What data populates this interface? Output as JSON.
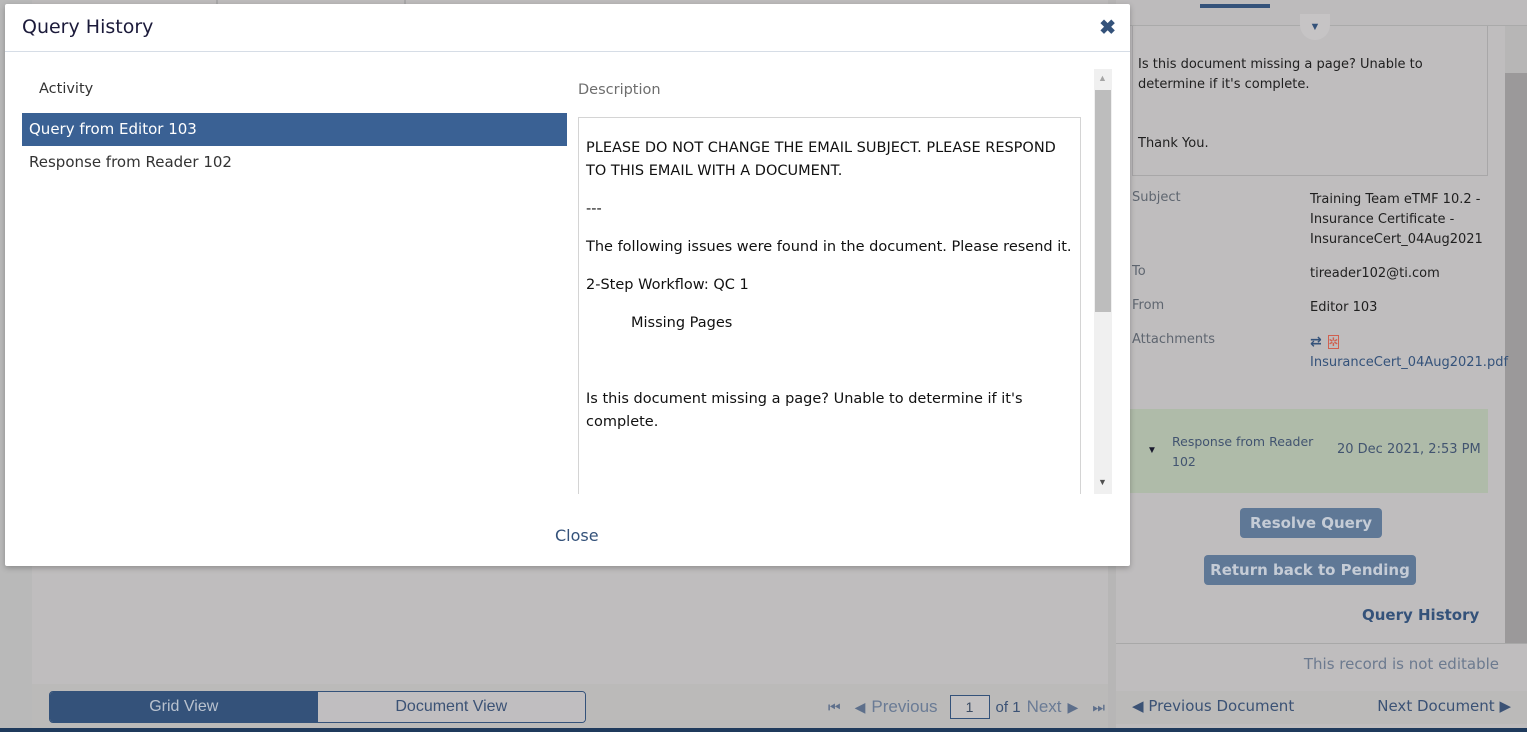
{
  "modal": {
    "title": "Query History",
    "close_icon": "close-icon",
    "activity": {
      "header": "Activity",
      "items": [
        {
          "label": "Query from Editor 103",
          "selected": true
        },
        {
          "label": "Response from Reader 102",
          "selected": false
        }
      ]
    },
    "description": {
      "header": "Description",
      "paragraphs": [
        "PLEASE DO NOT CHANGE THE EMAIL SUBJECT. PLEASE RESPOND TO THIS EMAIL WITH A DOCUMENT.",
        "---",
        "The following issues were found in the document. Please resend it.",
        "2-Step Workflow: QC 1",
        "Missing Pages",
        "Is this document missing a page? Unable to determine if it's complete."
      ]
    },
    "close_label": "Close"
  },
  "background": {
    "view_toggle": {
      "grid_label": "Grid View",
      "document_label": "Document View",
      "active": "Grid View"
    },
    "pager": {
      "previous_label": "Previous",
      "current_page": "1",
      "of_label": "of 1",
      "next_label": "Next"
    }
  },
  "right_panel": {
    "message": {
      "text": "Is this document missing a page? Unable to determine if it's complete.",
      "thanks": "Thank You."
    },
    "fields": {
      "subject_label": "Subject",
      "subject_value": "Training Team eTMF 10.2 - Insurance Certificate - InsuranceCert_04Aug2021",
      "to_label": "To",
      "to_value": "tireader102@ti.com",
      "from_label": "From",
      "from_value": "Editor 103",
      "attachments_label": "Attachments",
      "attachment_file": "InsuranceCert_04Aug2021.pdf"
    },
    "response": {
      "title": "Response from Reader 102",
      "date": "20 Dec 2021, 2:53 PM"
    },
    "buttons": {
      "resolve": "Resolve Query",
      "return_pending": "Return back to Pending",
      "query_history": "Query History"
    },
    "not_editable": "This record is not editable",
    "nav": {
      "previous": "Previous Document",
      "next": "Next Document"
    }
  }
}
